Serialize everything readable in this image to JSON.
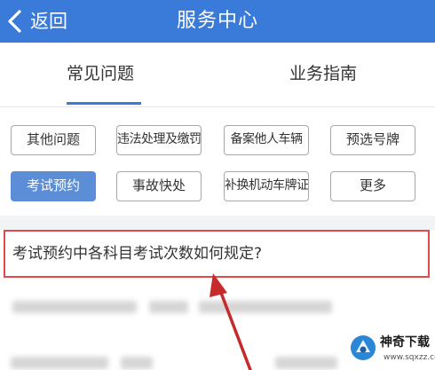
{
  "header": {
    "back_label": "返回",
    "title": "服务中心"
  },
  "tabs": [
    {
      "label": "常见问题",
      "active": true
    },
    {
      "label": "业务指南",
      "active": false
    }
  ],
  "categories": [
    {
      "label": "其他问题",
      "active": false
    },
    {
      "label": "违法处理及缴罚",
      "active": false
    },
    {
      "label": "备案他人车辆",
      "active": false
    },
    {
      "label": "预选号牌",
      "active": false
    },
    {
      "label": "考试预约",
      "active": true
    },
    {
      "label": "事故快处",
      "active": false
    },
    {
      "label": "补换机动车牌证",
      "active": false
    },
    {
      "label": "更多",
      "active": false
    }
  ],
  "questions": [
    {
      "text": "考试预约中各科目考试次数如何规定?",
      "highlighted": true
    }
  ],
  "watermark": {
    "name": "神奇下载",
    "url": "www.sqxzz.com"
  },
  "colors": {
    "nav_background": "#3a7ad8",
    "active_chip": "#5b8ed6",
    "highlight_border": "#e14a4a",
    "arrow": "#c62a2a"
  },
  "icons": {
    "back": "chevron-left-icon",
    "annotation": "red-arrow-icon",
    "watermark": "watermark-logo-icon"
  }
}
